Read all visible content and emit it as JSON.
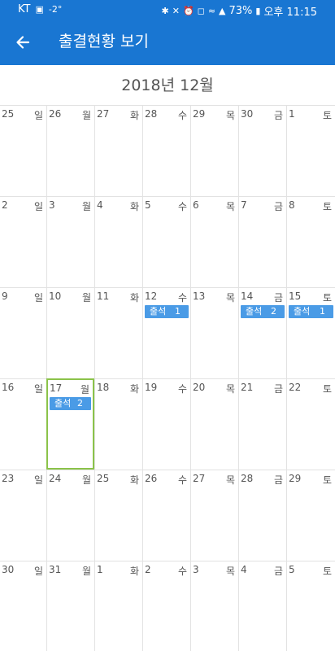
{
  "status_bar": {
    "carrier": "KT",
    "image_icon": "image-icon",
    "temperature": "-2°",
    "battery": "73%",
    "time": "오후 11:15",
    "icons": [
      "bluetooth-icon",
      "mute-icon",
      "alarm-icon",
      "hd-icon",
      "wifi-icon",
      "signal-icon",
      "battery-icon"
    ]
  },
  "app_bar": {
    "title": "출결현황 보기",
    "back_icon": "back-arrow-icon",
    "color": "#1976d2"
  },
  "calendar": {
    "month_label": "2018년 12월",
    "selected_color": "#8bc34a",
    "event_color": "#4a9be6",
    "weekdays": [
      "일",
      "월",
      "화",
      "수",
      "목",
      "금",
      "토"
    ],
    "weeks": [
      {
        "days": [
          {
            "num": "25",
            "dow": "일"
          },
          {
            "num": "26",
            "dow": "월"
          },
          {
            "num": "27",
            "dow": "화"
          },
          {
            "num": "28",
            "dow": "수"
          },
          {
            "num": "29",
            "dow": "목"
          },
          {
            "num": "30",
            "dow": "금"
          },
          {
            "num": "1",
            "dow": "토"
          }
        ]
      },
      {
        "days": [
          {
            "num": "2",
            "dow": "일"
          },
          {
            "num": "3",
            "dow": "월"
          },
          {
            "num": "4",
            "dow": "화"
          },
          {
            "num": "5",
            "dow": "수"
          },
          {
            "num": "6",
            "dow": "목"
          },
          {
            "num": "7",
            "dow": "금"
          },
          {
            "num": "8",
            "dow": "토"
          }
        ]
      },
      {
        "days": [
          {
            "num": "9",
            "dow": "일"
          },
          {
            "num": "10",
            "dow": "월"
          },
          {
            "num": "11",
            "dow": "화"
          },
          {
            "num": "12",
            "dow": "수",
            "event": {
              "label": "출석",
              "count": "1"
            }
          },
          {
            "num": "13",
            "dow": "목"
          },
          {
            "num": "14",
            "dow": "금",
            "event": {
              "label": "출석",
              "count": "2"
            }
          },
          {
            "num": "15",
            "dow": "토",
            "event": {
              "label": "출석",
              "count": "1"
            }
          }
        ]
      },
      {
        "days": [
          {
            "num": "16",
            "dow": "일"
          },
          {
            "num": "17",
            "dow": "월",
            "selected": true,
            "event": {
              "label": "출석",
              "count": "2"
            }
          },
          {
            "num": "18",
            "dow": "화"
          },
          {
            "num": "19",
            "dow": "수"
          },
          {
            "num": "20",
            "dow": "목"
          },
          {
            "num": "21",
            "dow": "금"
          },
          {
            "num": "22",
            "dow": "토"
          }
        ]
      },
      {
        "days": [
          {
            "num": "23",
            "dow": "일"
          },
          {
            "num": "24",
            "dow": "월"
          },
          {
            "num": "25",
            "dow": "화"
          },
          {
            "num": "26",
            "dow": "수"
          },
          {
            "num": "27",
            "dow": "목"
          },
          {
            "num": "28",
            "dow": "금"
          },
          {
            "num": "29",
            "dow": "토"
          }
        ]
      },
      {
        "days": [
          {
            "num": "30",
            "dow": "일"
          },
          {
            "num": "31",
            "dow": "월"
          },
          {
            "num": "1",
            "dow": "화"
          },
          {
            "num": "2",
            "dow": "수"
          },
          {
            "num": "3",
            "dow": "목"
          },
          {
            "num": "4",
            "dow": "금"
          },
          {
            "num": "5",
            "dow": "토"
          }
        ]
      }
    ]
  }
}
